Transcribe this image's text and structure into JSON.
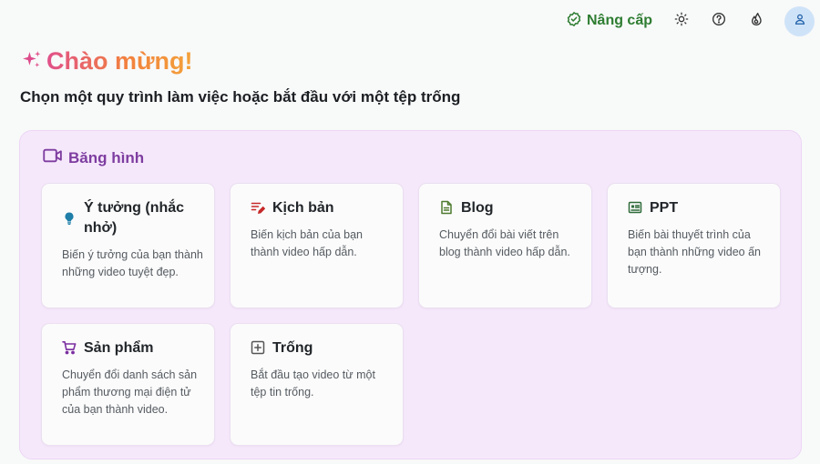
{
  "topbar": {
    "upgrade_label": "Nâng cấp",
    "icons": [
      "check-badge-icon",
      "sun-icon",
      "help-icon",
      "fire-icon",
      "user-icon"
    ]
  },
  "welcome": {
    "title": "Chào mừng!",
    "subtitle": "Chọn một quy trình làm việc hoặc bắt đầu với một tệp trống"
  },
  "section": {
    "title": "Băng hình",
    "cards": [
      {
        "title": "Ý tưởng (nhắc nhở)",
        "desc": "Biến ý tưởng của bạn thành những video tuyệt đẹp.",
        "icon": "lightbulb-icon"
      },
      {
        "title": "Kịch bản",
        "desc": "Biến kịch bản của bạn thành video hấp dẫn.",
        "icon": "script-icon"
      },
      {
        "title": "Blog",
        "desc": "Chuyển đổi bài viết trên blog thành video hấp dẫn.",
        "icon": "document-icon"
      },
      {
        "title": "PPT",
        "desc": "Biến bài thuyết trình của bạn thành những video ấn tượng.",
        "icon": "presentation-icon"
      },
      {
        "title": "Sản phẩm",
        "desc": "Chuyển đổi danh sách sản phẩm thương mại điện tử của bạn thành video.",
        "icon": "cart-icon"
      },
      {
        "title": "Trống",
        "desc": "Bắt đầu tạo video từ một tệp tin trống.",
        "icon": "plus-square-icon"
      }
    ]
  },
  "colors": {
    "upgrade": "#2e7d32",
    "section_title": "#7e3da0",
    "panel_bg": "#f6e8fb",
    "title_gradient": [
      "#e0508a",
      "#f3a23a"
    ]
  }
}
